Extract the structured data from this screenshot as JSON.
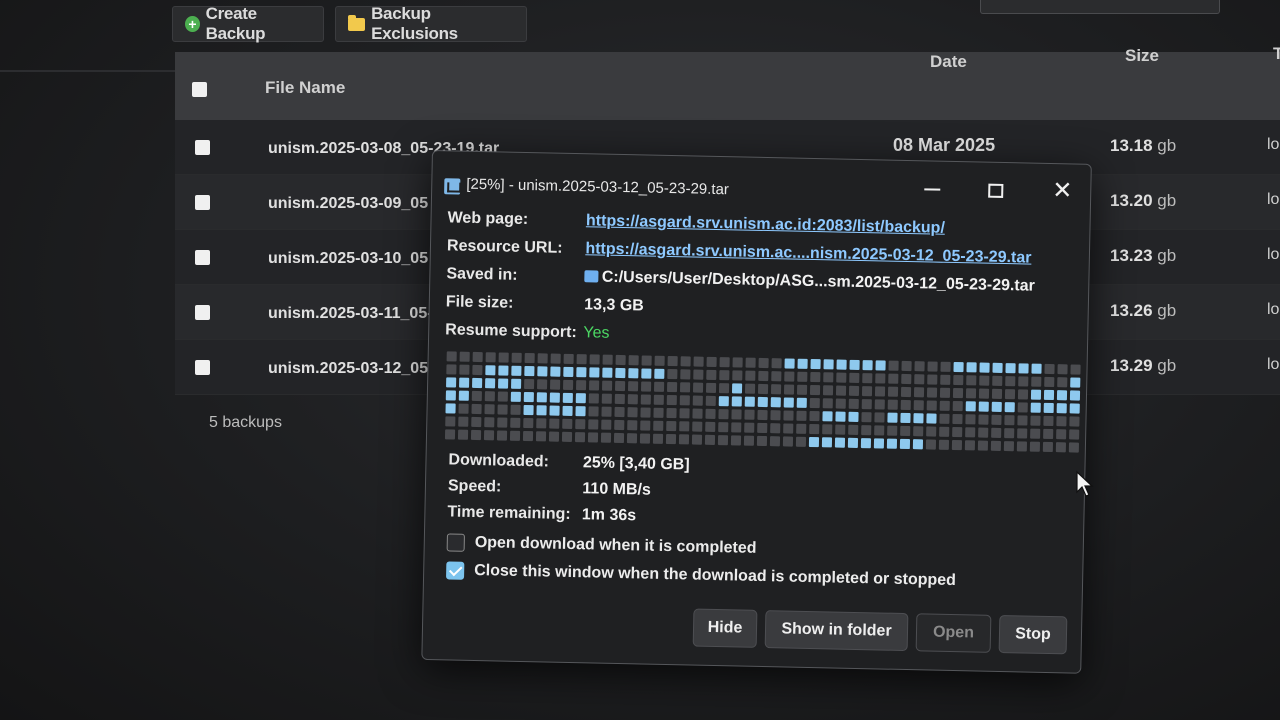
{
  "toolbar": {
    "create_backup": "Create Backup",
    "backup_exclusions": "Backup Exclusions"
  },
  "table": {
    "headers": {
      "file_name": "File Name",
      "date": "Date",
      "size": "Size",
      "type": "T"
    },
    "rows": [
      {
        "name": "unism.2025-03-08_05-23-19.tar",
        "date": "08 Mar 2025",
        "size": "13.18",
        "unit": "gb",
        "loc": "lo"
      },
      {
        "name": "unism.2025-03-09_05",
        "date": "",
        "size": "13.20",
        "unit": "gb",
        "loc": "lo"
      },
      {
        "name": "unism.2025-03-10_05",
        "date": "",
        "size": "13.23",
        "unit": "gb",
        "loc": "lo"
      },
      {
        "name": "unism.2025-03-11_05-",
        "date": "",
        "size": "13.26",
        "unit": "gb",
        "loc": "lo"
      },
      {
        "name": "unism.2025-03-12_05",
        "date": "",
        "size": "13.29",
        "unit": "gb",
        "loc": "loc"
      }
    ],
    "count": "5 backups"
  },
  "dialog": {
    "title": "[25%] - unism.2025-03-12_05-23-29.tar",
    "minimize": "",
    "maximize": "",
    "close": "✕",
    "web_page_label": "Web page:",
    "web_page": "https://asgard.srv.unism.ac.id:2083/list/backup/",
    "resource_url_label": "Resource URL:",
    "resource_url": "https://asgard.srv.unism.ac....nism.2025-03-12_05-23-29.tar",
    "saved_in_label": "Saved in:",
    "saved_in": "C:/Users/User/Desktop/ASG...sm.2025-03-12_05-23-29.tar",
    "file_size_label": "File size:",
    "file_size": "13,3 GB",
    "resume_label": "Resume support:",
    "resume": "Yes",
    "downloaded_label": "Downloaded:",
    "downloaded": "25% [3,40 GB]",
    "speed_label": "Speed:",
    "speed": "110 MB/s",
    "time_label": "Time remaining:",
    "time": "1m 36s",
    "option_open": "Open download when it is completed",
    "option_close": "Close this window when the download is completed or stopped",
    "option_open_checked": false,
    "option_close_checked": true,
    "btn_hide": "Hide",
    "btn_show": "Show in folder",
    "btn_open": "Open",
    "btn_stop": "Stop",
    "progress_fraction": 0.25
  },
  "colors": {
    "link": "#8ec9ff",
    "block_done": "#8ec9ee",
    "block_pending": "#4b4c50",
    "yes": "#4cd964"
  }
}
